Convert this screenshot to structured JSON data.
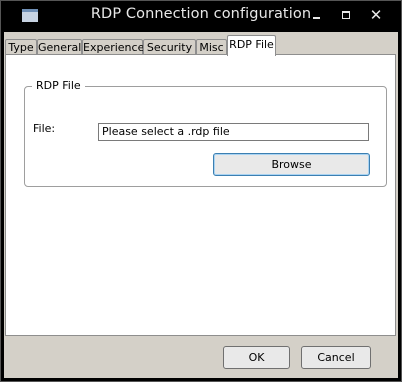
{
  "window": {
    "title": "RDP Connection configuration"
  },
  "tabs": [
    "Type",
    "General",
    "Experience",
    "Security",
    "Misc",
    "RDP File"
  ],
  "active_tab": "RDP File",
  "group": {
    "title": "RDP File",
    "file_label": "File:",
    "file_value": "Please select a .rdp file",
    "browse_label": "Browse"
  },
  "footer": {
    "ok_label": "OK",
    "cancel_label": "Cancel"
  },
  "colors": {
    "title_bar": "#000000",
    "dialog_background": "#d4d0c8",
    "panel_background": "#ffffff",
    "focus_accent": "#3c7fb1"
  }
}
